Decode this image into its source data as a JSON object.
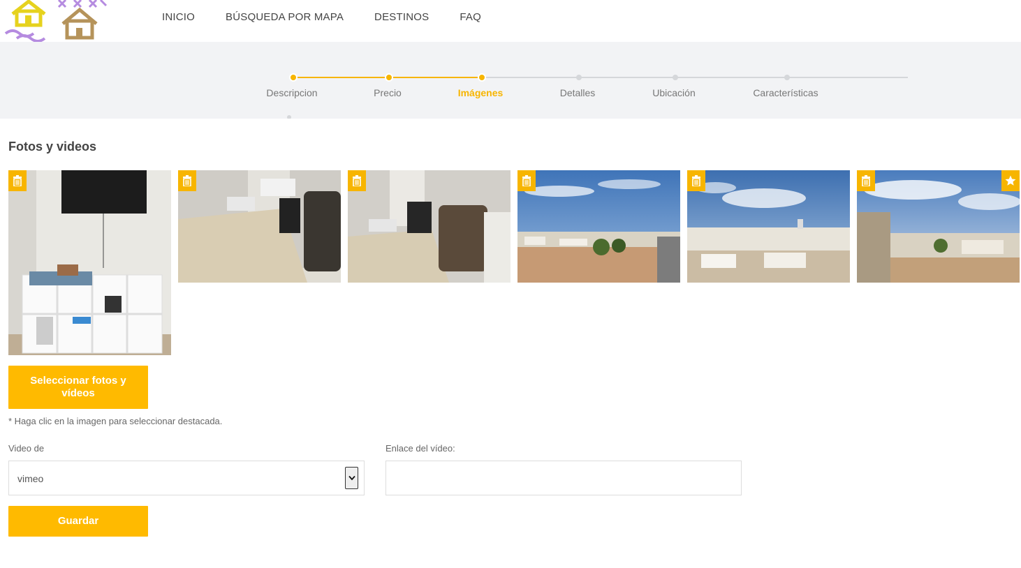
{
  "nav": {
    "items": [
      "INICIO",
      "BÚSQUEDA POR MAPA",
      "DESTINOS",
      "FAQ"
    ]
  },
  "stepper": {
    "steps": [
      "Descripcion",
      "Precio",
      "Imágenes",
      "Detalles",
      "Ubicación",
      "Características"
    ],
    "current_index": 2,
    "accent_color": "#f7b500",
    "inactive_color": "#d5d7da"
  },
  "photos": {
    "title": "Fotos y videos",
    "items": [
      {
        "scene": "tv-shelf",
        "featured": false
      },
      {
        "scene": "desk-chair",
        "featured": false
      },
      {
        "scene": "desk-chair-2",
        "featured": false
      },
      {
        "scene": "town-view",
        "featured": false
      },
      {
        "scene": "town-view-2",
        "featured": false
      },
      {
        "scene": "town-view-3",
        "featured": true
      }
    ],
    "select_button": "Seleccionar fotos y vídeos",
    "hint": "* Haga clic en la imagen para seleccionar destacada."
  },
  "video": {
    "source_label": "Video de",
    "source_value": "vimeo",
    "link_label": "Enlace del vídeo:",
    "link_value": ""
  },
  "save_button": "Guardar",
  "icons": {
    "delete": "trash-icon",
    "featured": "star-icon",
    "dropdown": "chevron-down-icon"
  }
}
